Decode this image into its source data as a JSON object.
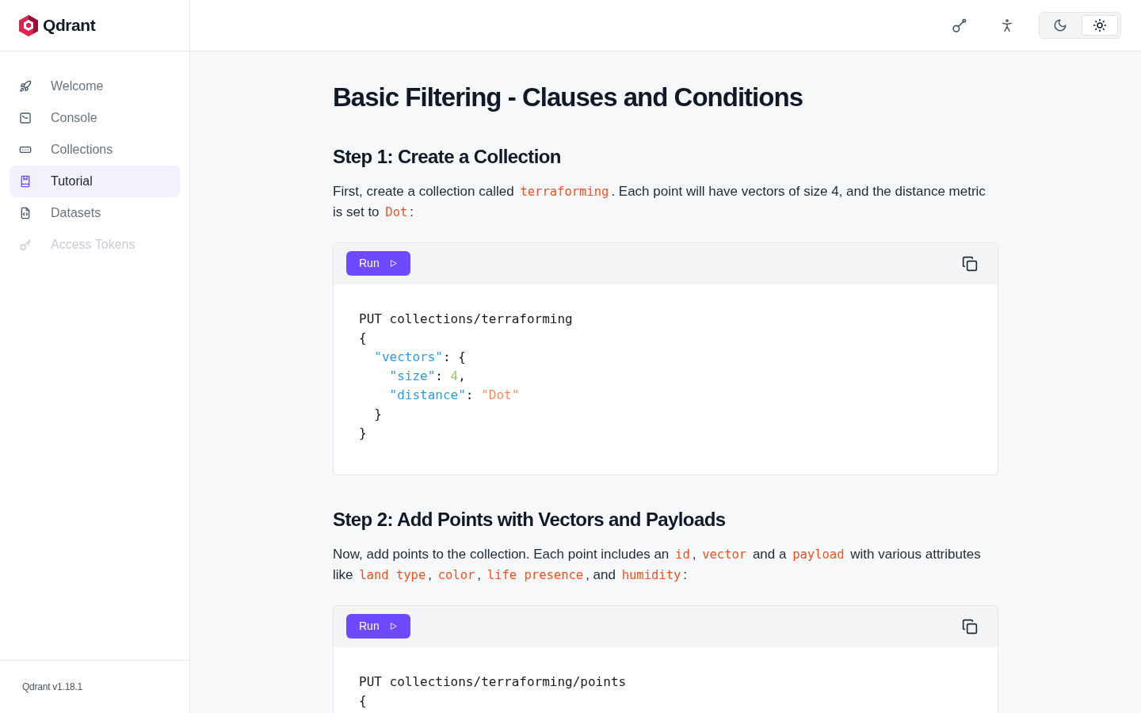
{
  "sidebar": {
    "brand": "Qdrant",
    "items": [
      {
        "label": "Welcome",
        "selected": false,
        "disabled": false
      },
      {
        "label": "Console",
        "selected": false,
        "disabled": false
      },
      {
        "label": "Collections",
        "selected": false,
        "disabled": false
      },
      {
        "label": "Tutorial",
        "selected": true,
        "disabled": false
      },
      {
        "label": "Datasets",
        "selected": false,
        "disabled": false
      },
      {
        "label": "Access Tokens",
        "selected": false,
        "disabled": true
      }
    ],
    "version": "Qdrant v1.18.1"
  },
  "header": {
    "theme_toggle": [
      {
        "selected": false
      },
      {
        "selected": true
      }
    ]
  },
  "content": {
    "title": "Basic Filtering - Clauses and Conditions",
    "sections": [
      {
        "heading": "Step 1: Create a Collection",
        "paragraph": [
          {
            "kind": "text",
            "text": "First, create a collection called "
          },
          {
            "kind": "code",
            "text": "terraforming"
          },
          {
            "kind": "text",
            "text": ". Each point will have vectors of size 4, and the distance metric is set to "
          },
          {
            "kind": "code",
            "text": "Dot"
          },
          {
            "kind": "text",
            "text": ":"
          }
        ],
        "code_block": {
          "run_label": "Run",
          "lines": [
            [
              {
                "kind": "plain",
                "text": "PUT collections/terraforming"
              }
            ],
            [
              {
                "kind": "plain",
                "text": "{"
              }
            ],
            [
              {
                "kind": "key",
                "text": "  \"vectors\""
              },
              {
                "kind": "plain",
                "text": ": {"
              }
            ],
            [
              {
                "kind": "key",
                "text": "    \"size\""
              },
              {
                "kind": "plain",
                "text": ": "
              },
              {
                "kind": "number",
                "text": "4"
              },
              {
                "kind": "plain",
                "text": ","
              }
            ],
            [
              {
                "kind": "key",
                "text": "    \"distance\""
              },
              {
                "kind": "plain",
                "text": ": "
              },
              {
                "kind": "string",
                "text": "\"Dot\""
              }
            ],
            [
              {
                "kind": "plain",
                "text": "  }"
              }
            ],
            [
              {
                "kind": "plain",
                "text": "}"
              }
            ]
          ]
        }
      },
      {
        "heading": "Step 2: Add Points with Vectors and Payloads",
        "paragraph": [
          {
            "kind": "text",
            "text": "Now, add points to the collection. Each point includes an "
          },
          {
            "kind": "code",
            "text": "id"
          },
          {
            "kind": "text",
            "text": ", "
          },
          {
            "kind": "code",
            "text": "vector"
          },
          {
            "kind": "text",
            "text": " and a "
          },
          {
            "kind": "code",
            "text": "payload"
          },
          {
            "kind": "text",
            "text": " with various attributes like "
          },
          {
            "kind": "code",
            "text": "land type"
          },
          {
            "kind": "text",
            "text": ", "
          },
          {
            "kind": "code",
            "text": "color"
          },
          {
            "kind": "text",
            "text": ", "
          },
          {
            "kind": "code",
            "text": "life presence"
          },
          {
            "kind": "text",
            "text": ", and "
          },
          {
            "kind": "code",
            "text": "humidity"
          },
          {
            "kind": "text",
            "text": ":"
          }
        ],
        "code_block": {
          "run_label": "Run",
          "lines": [
            [
              {
                "kind": "plain",
                "text": "PUT collections/terraforming/points"
              }
            ],
            [
              {
                "kind": "plain",
                "text": "{"
              }
            ]
          ]
        }
      }
    ]
  }
}
